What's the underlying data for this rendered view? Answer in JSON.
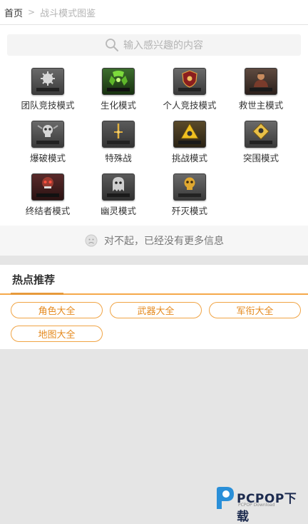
{
  "breadcrumb": {
    "home": "首页",
    "separator": ">",
    "current": "战斗模式图鉴"
  },
  "search": {
    "placeholder": "输入感兴趣的内容",
    "icon": "search-icon"
  },
  "modes": [
    {
      "label": "团队竞技模式",
      "icon": "gear-emblem-icon",
      "icon_caption": "团队竞技模式"
    },
    {
      "label": "生化模式",
      "icon": "biohazard-icon",
      "icon_caption": "生化模式"
    },
    {
      "label": "个人竞技模式",
      "icon": "shield-emblem-icon",
      "icon_caption": "个人竞技模式"
    },
    {
      "label": "救世主模式",
      "icon": "soldier-icon",
      "icon_caption": "救世主模式"
    },
    {
      "label": "爆破模式",
      "icon": "skull-emblem-icon",
      "icon_caption": "爆破模式"
    },
    {
      "label": "特殊战",
      "icon": "crossed-swords-icon",
      "icon_caption": "特殊战"
    },
    {
      "label": "挑战模式",
      "icon": "hazard-triangle-icon",
      "icon_caption": "挑战模式"
    },
    {
      "label": "突围模式",
      "icon": "diamond-skull-icon",
      "icon_caption": "突围模式"
    },
    {
      "label": "终结者模式",
      "icon": "mech-skull-icon",
      "icon_caption": "终结者模式"
    },
    {
      "label": "幽灵模式",
      "icon": "ghost-icon",
      "icon_caption": "幽灵模式"
    },
    {
      "label": "歼灭模式",
      "icon": "gold-skull-icon",
      "icon_caption": "歼灭"
    }
  ],
  "status": {
    "no_more": "对不起，已经没有更多信息",
    "icon": "sad-face-icon"
  },
  "hot": {
    "title": "热点推荐",
    "tags": [
      "角色大全",
      "武器大全",
      "军衔大全",
      "地图大全"
    ]
  },
  "watermark": {
    "brand": "PCPOP下载",
    "sub": "PCPOP Download"
  },
  "colors": {
    "accent": "#f0a445",
    "accent_text": "#e58a1f",
    "background": "#e5e5e5"
  }
}
